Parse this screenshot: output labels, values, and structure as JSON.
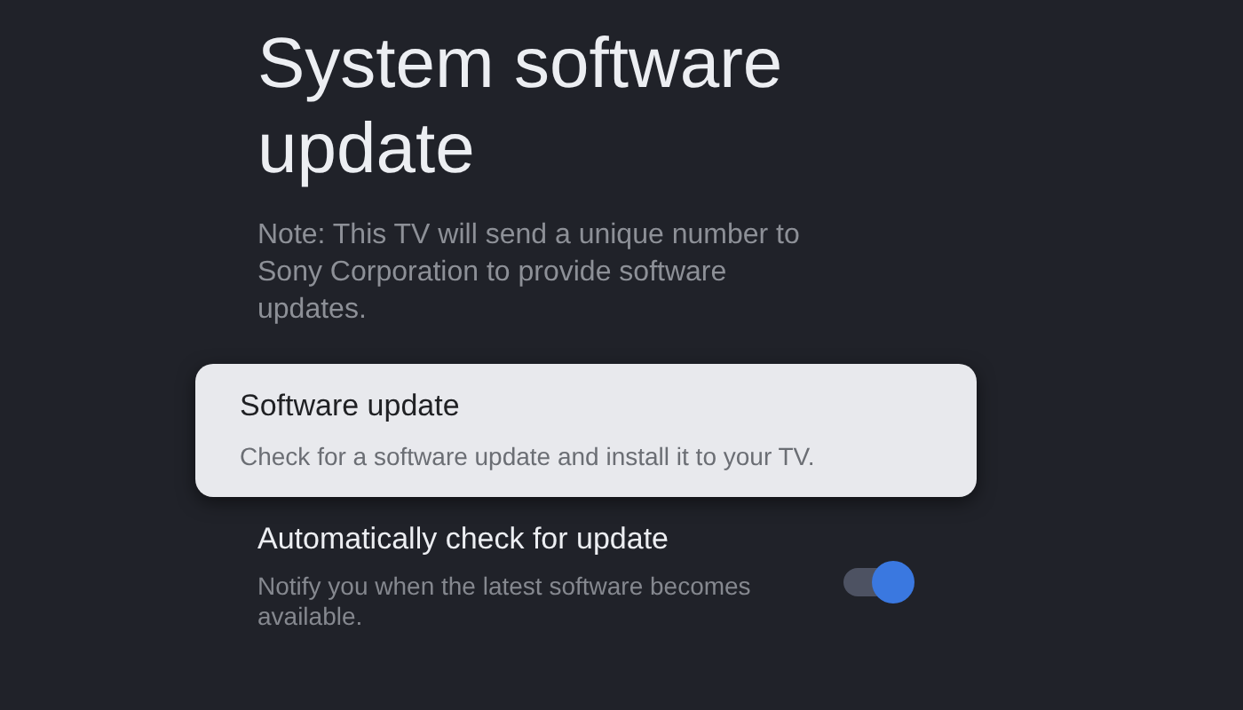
{
  "page": {
    "title": "System software update",
    "note": "Note: This TV will send a unique number to Sony Corporation to provide software updates."
  },
  "items": [
    {
      "kind": "action",
      "title": "Software update",
      "description": "Check for a software update and install it to your TV.",
      "selected": true
    },
    {
      "kind": "toggle",
      "title": "Automatically check for update",
      "description": "Notify you when the latest software becomes available.",
      "selected": false,
      "on": true
    }
  ]
}
